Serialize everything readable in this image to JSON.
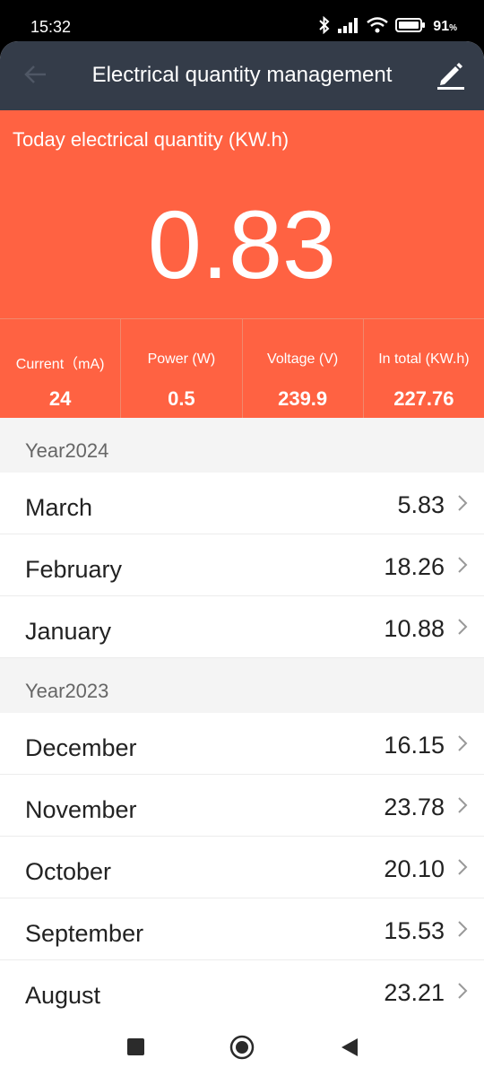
{
  "status_bar": {
    "time": "15:32",
    "battery": "91"
  },
  "header": {
    "title": "Electrical quantity management",
    "back_icon": "arrow-left-icon",
    "edit_icon": "pencil-icon"
  },
  "today": {
    "label": "Today electrical quantity (KW.h)",
    "value": "0.83"
  },
  "stats": [
    {
      "label": "Current（mA)",
      "value": "24"
    },
    {
      "label": "Power (W)",
      "value": "0.5"
    },
    {
      "label": "Voltage (V)",
      "value": "239.9"
    },
    {
      "label": "In total (KW.h)",
      "value": "227.76"
    }
  ],
  "years": [
    {
      "label": "Year2024",
      "months": [
        {
          "name": "March",
          "value": "5.83"
        },
        {
          "name": "February",
          "value": "18.26"
        },
        {
          "name": "January",
          "value": "10.88"
        }
      ]
    },
    {
      "label": "Year2023",
      "months": [
        {
          "name": "December",
          "value": "16.15"
        },
        {
          "name": "November",
          "value": "23.78"
        },
        {
          "name": "October",
          "value": "20.10"
        },
        {
          "name": "September",
          "value": "15.53"
        },
        {
          "name": "August",
          "value": "23.21"
        }
      ]
    }
  ],
  "colors": {
    "header_bg": "#343c49",
    "accent": "#ff6242"
  }
}
